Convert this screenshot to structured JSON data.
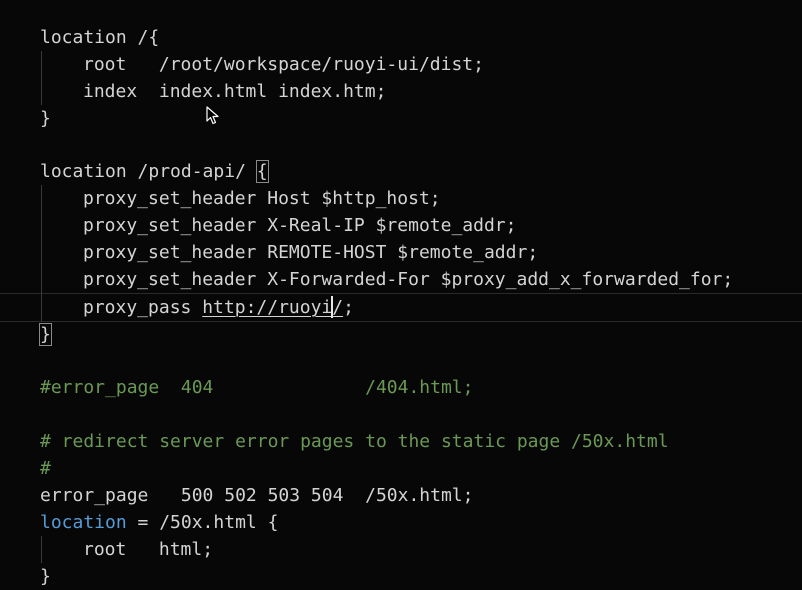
{
  "editor": {
    "lines": [
      "location /{",
      "root   /root/workspace/ruoyi-ui/dist;",
      "index  index.html index.htm;",
      "}",
      "location /prod-api/ ",
      "{",
      "proxy_set_header Host $http_host;",
      "proxy_set_header X-Real-IP $remote_addr;",
      "proxy_set_header REMOTE-HOST $remote_addr;",
      "proxy_set_header X-Forwarded-For $proxy_add_x_forwarded_for;",
      "proxy_pass ",
      "http://ruoyi",
      "/",
      ";",
      "}",
      "#error_page  404              /404.html;",
      "# redirect server error pages to the static page /50x.html",
      "#",
      "error_page   500 502 503 504  /50x.html;",
      "location",
      " = /50x.html {",
      "root   html;",
      "}"
    ]
  }
}
